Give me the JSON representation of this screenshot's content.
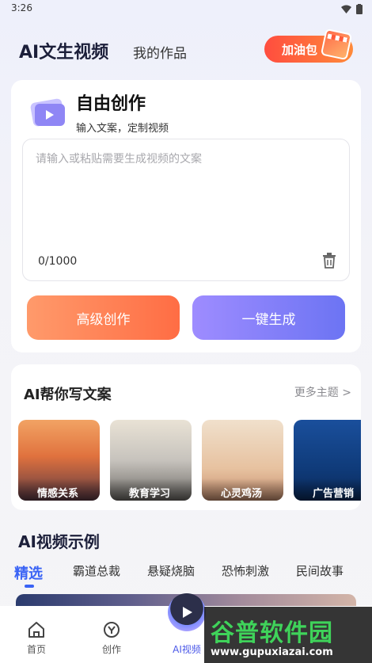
{
  "status": {
    "time": "3:26"
  },
  "header": {
    "title": "AI文生视频",
    "tab_my_works": "我的作品",
    "promo_label": "加油包"
  },
  "create": {
    "title": "自由创作",
    "subtitle": "输入文案，定制视频",
    "placeholder": "请输入或粘贴需要生成视频的文案",
    "char_count": "0/1000",
    "btn_advanced": "高级创作",
    "btn_generate": "一键生成"
  },
  "ai_copy": {
    "title": "AI帮你写文案",
    "more": "更多主题 >",
    "topics": [
      {
        "label": "情感关系"
      },
      {
        "label": "教育学习"
      },
      {
        "label": "心灵鸡汤"
      },
      {
        "label": "广告营销"
      }
    ]
  },
  "examples": {
    "title": "AI视频示例",
    "tabs": [
      "精选",
      "霸道总裁",
      "悬疑烧脑",
      "恐怖刺激",
      "民间故事"
    ]
  },
  "nav": {
    "home": "首页",
    "create": "创作",
    "ai_video": "AI视频"
  },
  "watermark": {
    "main": "谷普软件园",
    "url": "www.gupuxiazai.com"
  },
  "colors": {
    "accent": "#3a63f5",
    "orange": "#ff6d44",
    "purple": "#6c74f3"
  }
}
